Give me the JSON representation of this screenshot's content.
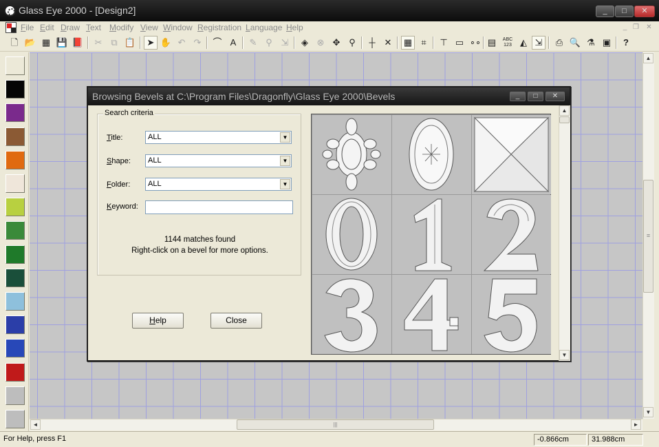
{
  "window": {
    "title": "Glass Eye 2000 - [Design2]",
    "controls": {
      "minimize": "_",
      "maximize": "□",
      "close": "✕"
    }
  },
  "menu": {
    "items": [
      {
        "label": "File",
        "mnemonic": "F",
        "rest": "ile"
      },
      {
        "label": "Edit",
        "mnemonic": "E",
        "rest": "dit"
      },
      {
        "label": "Draw",
        "mnemonic": "D",
        "rest": "raw"
      },
      {
        "label": "Text",
        "mnemonic": "T",
        "rest": "ext"
      },
      {
        "label": "Modify",
        "mnemonic": "M",
        "rest": "odify"
      },
      {
        "label": "View",
        "mnemonic": "V",
        "rest": "iew"
      },
      {
        "label": "Window",
        "mnemonic": "W",
        "rest": "indow"
      },
      {
        "label": "Registration",
        "mnemonic": "R",
        "rest": "egistration"
      },
      {
        "label": "Language",
        "mnemonic": "L",
        "rest": "anguage"
      },
      {
        "label": "Help",
        "mnemonic": "H",
        "rest": "elp"
      }
    ],
    "mdi_controls": {
      "minimize": "_",
      "restore": "❐",
      "close": "✕"
    }
  },
  "toolbar": {
    "icons": [
      "new-icon",
      "open-icon",
      "grid-palette-icon",
      "save-icon",
      "book-icon",
      "cut-icon",
      "copy-icon",
      "paste-icon",
      "select-arrow-icon",
      "hand-icon",
      "undo-icon",
      "redo-icon",
      "curve-icon",
      "text-icon",
      "pencil-icon",
      "stamp-icon",
      "fill-icon",
      "cancel-icon",
      "move-icon",
      "magnify-icon",
      "crosshair-icon",
      "cross-icon",
      "grid-icon",
      "snap-icon",
      "dimension-icon",
      "ruler-icon",
      "nodes-icon",
      "calculator-icon",
      "spellcheck-icon",
      "bevel-icon",
      "export-icon",
      "print-icon",
      "print-preview-icon",
      "color-picker-icon",
      "window-icon",
      "context-help-icon"
    ],
    "glyphs": {
      "new": "🗋",
      "open": "📂",
      "palette": "▦",
      "save": "💾",
      "book": "📕",
      "cut": "✂",
      "copy": "⧉",
      "paste": "📋",
      "select": "➤",
      "hand": "✋",
      "undo": "↶",
      "redo": "↷",
      "curve": "⌒",
      "text": "A",
      "pencil": "✎",
      "stamp": "⚲",
      "fill": "◈",
      "cancel": "⊗",
      "move": "✥",
      "magnify": "⚲",
      "crosshair": "┼",
      "cross": "✕",
      "grid": "▦",
      "snap": "⌗",
      "dimension": "⊤",
      "ruler": "▭",
      "nodes": "∘∘",
      "calc": "▤",
      "abc_top": "ABC",
      "abc_bottom": "123",
      "bevel": "◭",
      "export": "⇲",
      "print": "⎙",
      "preview": "🔍",
      "picker": "⚗",
      "window": "▣",
      "help": "?"
    }
  },
  "palette": {
    "swatches": [
      "#ece9d8",
      "#050505",
      "#7a2a8c",
      "#8b5a34",
      "#e06a10",
      "#efe6da",
      "#b8d040",
      "#3a8a3a",
      "#1f7a2a",
      "#1a4f3a",
      "#8ec0dc",
      "#2b3ea8",
      "#2848b8",
      "#c01a1a",
      "#bdbdbd",
      "#bdbdbd"
    ]
  },
  "statusbar": {
    "help": "For Help, press F1",
    "x": "-0.866cm",
    "y": "31.988cm"
  },
  "dialog": {
    "title": "Browsing Bevels at C:\\Program Files\\Dragonfly\\Glass Eye 2000\\Bevels",
    "controls": {
      "minimize": "_",
      "maximize": "□",
      "close": "✕"
    },
    "group_label": "Search criteria",
    "fields": {
      "title": {
        "mnemonic": "T",
        "rest": "itle:",
        "value": "ALL"
      },
      "shape": {
        "mnemonic": "S",
        "rest": "hape:",
        "value": "ALL"
      },
      "folder": {
        "mnemonic": "F",
        "rest": "older:",
        "value": "ALL"
      },
      "keyword": {
        "mnemonic": "K",
        "rest": "eyword:",
        "value": ""
      }
    },
    "matches": "1144 matches found",
    "hint": "Right-click on a bevel for more options.",
    "help_button": {
      "mnemonic": "H",
      "rest": "elp"
    },
    "close_button": "Close",
    "bevels": [
      "ornament",
      "oval",
      "square",
      "0",
      "1",
      "2",
      "3",
      "4",
      "5"
    ]
  },
  "scroll": {
    "left": "◄",
    "right": "►",
    "up": "▲",
    "down": "▼",
    "grip": "|||",
    "vgrip": "≡"
  }
}
